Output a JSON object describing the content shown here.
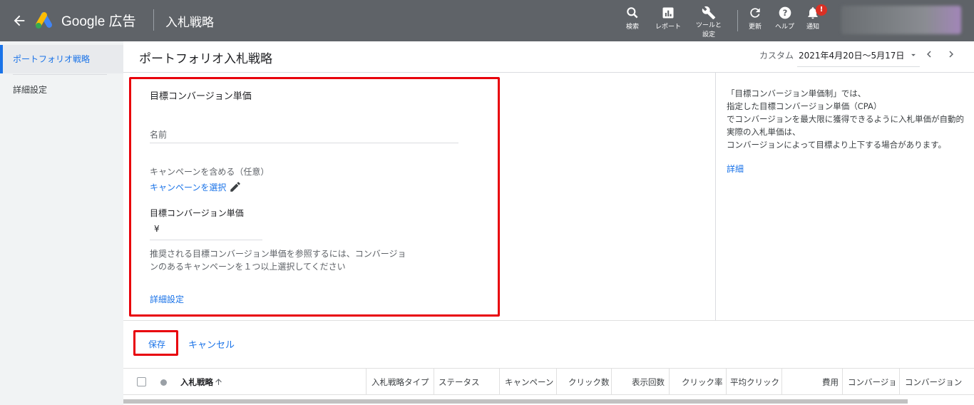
{
  "header": {
    "brand": "Google 広告",
    "section_title": "入札戦略",
    "tools": [
      {
        "label": "検索",
        "icon": "search-icon"
      },
      {
        "label": "レポート",
        "icon": "reports-icon"
      },
      {
        "label": "ツールと\n設定",
        "icon": "wrench-icon"
      },
      {
        "label": "更新",
        "icon": "refresh-icon"
      },
      {
        "label": "ヘルプ",
        "icon": "help-icon"
      },
      {
        "label": "通知",
        "icon": "bell-icon"
      }
    ],
    "notification_badge": "!"
  },
  "sidebar": {
    "items": [
      {
        "label": "ポートフォリオ戦略",
        "active": true
      },
      {
        "label": "詳細設定",
        "active": false
      }
    ]
  },
  "main": {
    "page_title": "ポートフォリオ入札戦略",
    "date_label": "カスタム",
    "date_range": "2021年4月20日～5月17日"
  },
  "form": {
    "title": "目標コンバージョン単価",
    "name_placeholder": "名前",
    "campaigns_label": "キャンペーンを含める（任意）",
    "select_campaigns_link": "キャンペーンを選択",
    "target_cpa_label": "目標コンバージョン単価",
    "currency_symbol": "¥",
    "hint_line1": "推奨される目標コンバージョン単価を参照するには、コンバージョ",
    "hint_line2": "ンのあるキャンペーンを１つ以上選択してください",
    "advanced_link": "詳細設定"
  },
  "info_panel": {
    "lines": [
      "「目標コンバージョン単価制」では、",
      "指定した目標コンバージョン単価（CPA）",
      "でコンバージョンを最大限に獲得できるように入札単価が自動的",
      "実際の入札単価は、",
      "コンバージョンによって目標より上下する場合があります。"
    ],
    "details_link": "詳細"
  },
  "actions": {
    "save": "保存",
    "cancel": "キャンセル"
  },
  "table": {
    "columns": [
      "入札戦略",
      "入札戦略タイプ",
      "ステータス",
      "キャンペーン",
      "クリック数",
      "表示回数",
      "クリック率",
      "平均クリック",
      "費用",
      "コンバージョ",
      "コンバージョン"
    ]
  },
  "colors": {
    "header_bg": "#5f6368",
    "accent": "#1a73e8",
    "highlight_red": "#e8000b"
  }
}
